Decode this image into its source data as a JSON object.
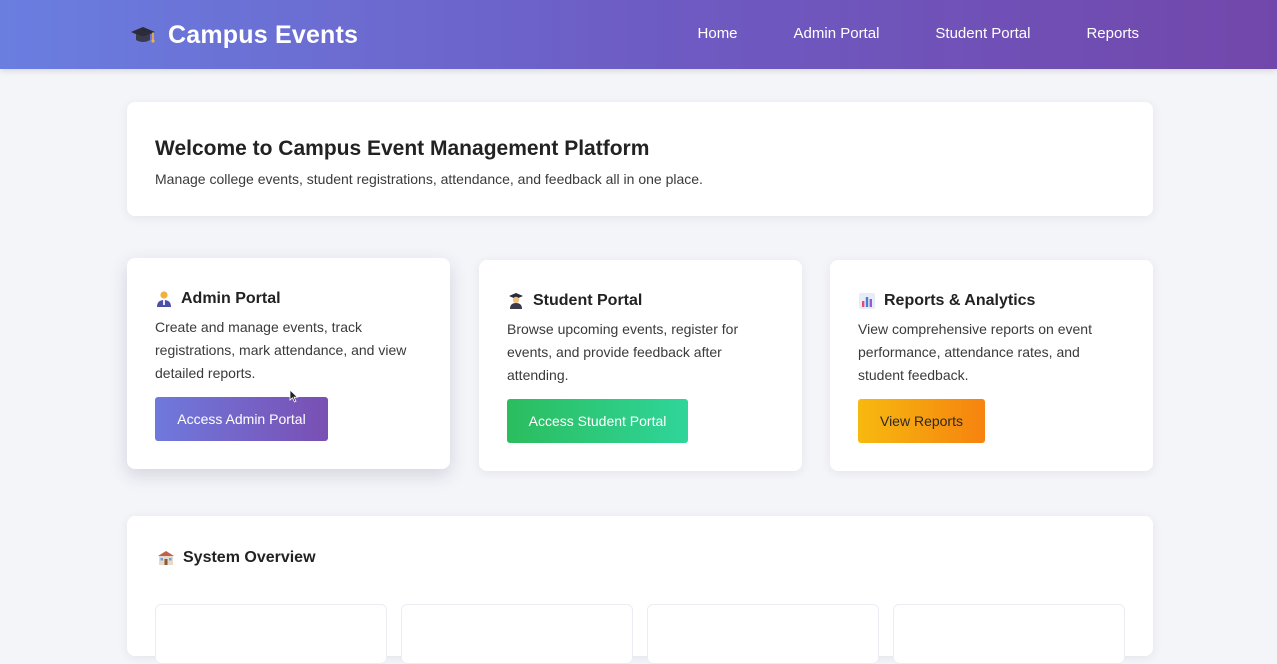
{
  "nav": {
    "brand": "Campus Events",
    "brand_icon": "graduation-cap-icon",
    "links": [
      "Home",
      "Admin Portal",
      "Student Portal",
      "Reports"
    ]
  },
  "welcome": {
    "title": "Welcome to Campus Event Management Platform",
    "subtitle": "Manage college events, student registrations, attendance, and feedback all in one place."
  },
  "cards": {
    "admin": {
      "icon": "admin-user-icon",
      "title": "Admin Portal",
      "description": "Create and manage events, track registrations, mark attendance, and view detailed reports.",
      "button": "Access Admin Portal"
    },
    "student": {
      "icon": "student-icon",
      "title": "Student Portal",
      "description": "Browse upcoming events, register for events, and provide feedback after attending.",
      "button": "Access Student Portal"
    },
    "reports": {
      "icon": "bar-chart-icon",
      "title": "Reports & Analytics",
      "description": "View comprehensive reports on event performance, attendance rates, and student feedback.",
      "button": "View Reports"
    }
  },
  "overview": {
    "icon": "school-building-icon",
    "title": "System Overview"
  },
  "colors": {
    "nav_gradient_start": "#6a7ee0",
    "nav_gradient_end": "#7247ab",
    "admin_button": "#7562c6",
    "student_button": "#2cc77a",
    "reports_button": "#f6a00f",
    "background": "#f4f5f9"
  }
}
